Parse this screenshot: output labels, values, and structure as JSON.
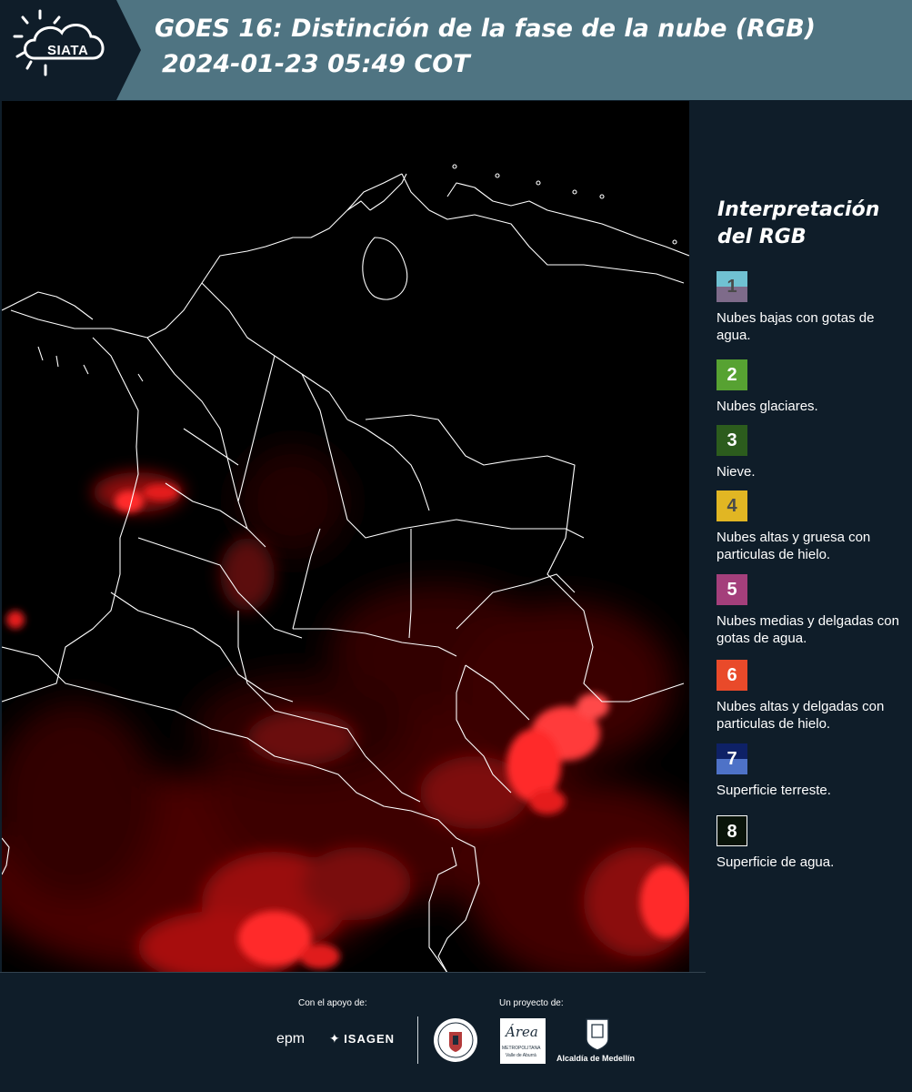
{
  "header": {
    "logo_text": "SIATA",
    "title_line1": "GOES 16: Distinción de la fase de la nube (RGB)",
    "title_line2": "2024-01-23 05:49 COT"
  },
  "legend": {
    "heading_line1": "Interpretación",
    "heading_line2": "del RGB",
    "items": [
      {
        "number": "1",
        "label": "Nubes bajas con gotas de agua.",
        "color_top": "#70c1d2",
        "color_bottom": "#7e6b8a",
        "num_color": "#4a4a4a"
      },
      {
        "number": "2",
        "label": "Nubes glaciares.",
        "color": "#57a232",
        "num_color": "#ffffff"
      },
      {
        "number": "3",
        "label": "Nieve.",
        "color": "#2c5c1d",
        "num_color": "#ffffff"
      },
      {
        "number": "4",
        "label": "Nubes altas y gruesa con particulas de hielo.",
        "color": "#e1b623",
        "num_color": "#4a4a4a"
      },
      {
        "number": "5",
        "label": "Nubes medias y delgadas con gotas de agua.",
        "color": "#a43f7b",
        "num_color": "#ffffff"
      },
      {
        "number": "6",
        "label": "Nubes altas y delgadas con particulas de hielo.",
        "color": "#e94a2a",
        "num_color": "#ffffff"
      },
      {
        "number": "7",
        "label": "Superficie terreste.",
        "color_top": "#0e2166",
        "color_bottom": "#4e72c7",
        "num_color": "#ffffff"
      },
      {
        "number": "8",
        "label": "Superficie de agua.",
        "color": "#0a140a",
        "border": "#ffffff",
        "num_color": "#ffffff"
      }
    ]
  },
  "footer": {
    "support_label": "Con el apoyo de:",
    "project_label": "Un proyecto de:",
    "sponsor_epm": "epm",
    "sponsor_isagen": "ISAGEN",
    "sponsor_area": "Área",
    "sponsor_area_sub1": "METROPOLITANA",
    "sponsor_area_sub2": "Valle de Aburrá",
    "sponsor_alcaldia": "Alcaldía de Medellín"
  },
  "colors": {
    "header_bg": "#4f7482",
    "logo_tab_bg": "#0f1d29",
    "page_bg": "#0f1d29",
    "cloud_red": "#ff2020",
    "border_lines": "#ffffff"
  }
}
